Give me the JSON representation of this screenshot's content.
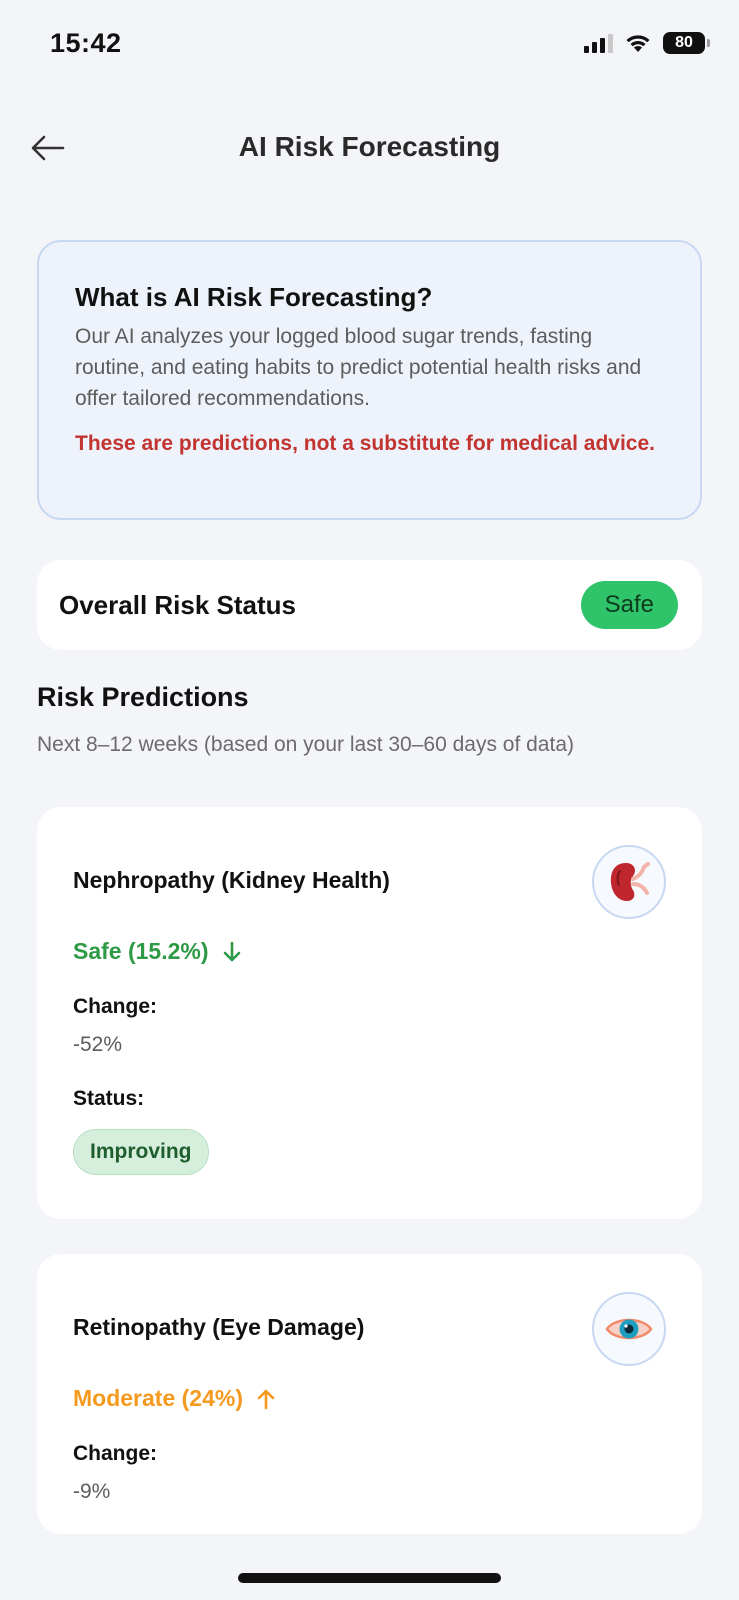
{
  "status_bar": {
    "time": "15:42",
    "battery": "80"
  },
  "header": {
    "title": "AI Risk Forecasting"
  },
  "info": {
    "title": "What is AI Risk Forecasting?",
    "body": "Our AI analyzes your logged blood sugar trends, fasting routine, and eating habits to predict potential health risks and offer tailored recommendations.",
    "warning": "These are predictions, not a substitute for medical advice."
  },
  "overall": {
    "label": "Overall Risk Status",
    "status": "Safe"
  },
  "predictions": {
    "title": "Risk Predictions",
    "subtitle": "Next 8–12 weeks (based on your last 30–60 days of data)",
    "items": [
      {
        "name": "Nephropathy (Kidney Health)",
        "icon": "kidney-icon",
        "risk": "Safe (15.2%)",
        "trend": "down",
        "change_label": "Change:",
        "change": "-52%",
        "status_label": "Status:",
        "status": "Improving",
        "risk_color": "#2e9a46"
      },
      {
        "name": "Retinopathy (Eye Damage)",
        "icon": "eye-icon",
        "risk": "Moderate (24%)",
        "trend": "up",
        "change_label": "Change:",
        "change": "-9%",
        "risk_color": "#f59a1e"
      }
    ]
  }
}
